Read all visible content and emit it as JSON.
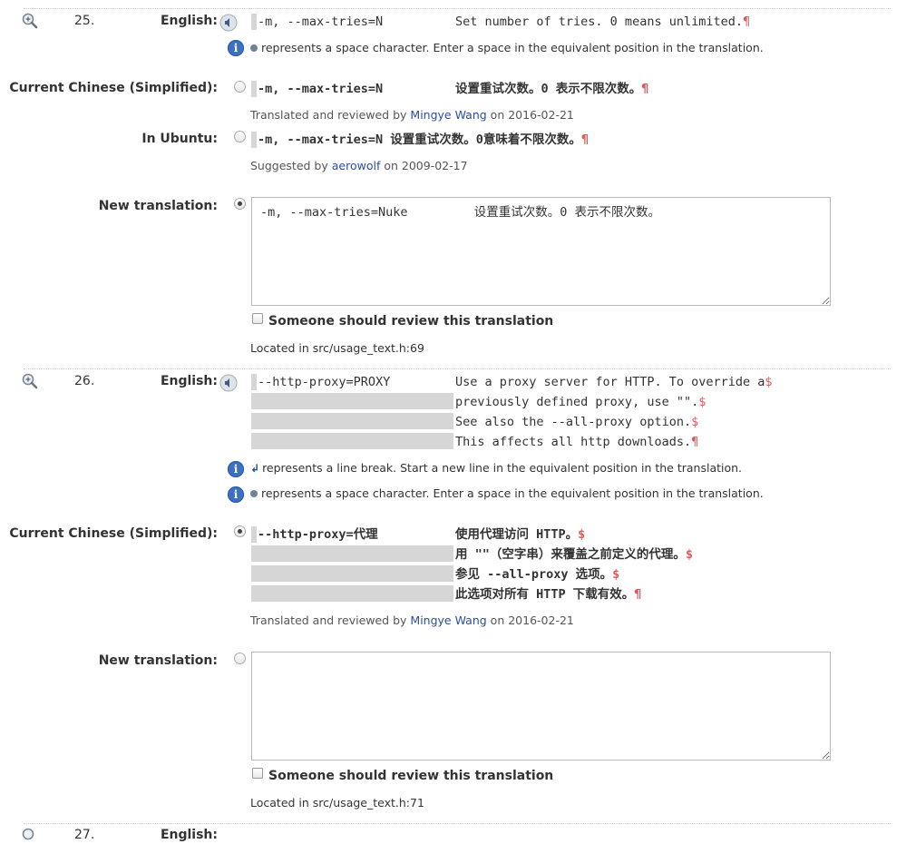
{
  "msg25": {
    "number": "25.",
    "english_label": "English:",
    "english": {
      "left": "-m, --max-tries=N",
      "right": "Set number of tries. 0 means unlimited.",
      "mark": "¶"
    },
    "space_note": "represents a space character. Enter a space in the equivalent position in the translation.",
    "current_label": "Current Chinese (Simplified):",
    "current": {
      "left": "-m, --max-tries=N",
      "right": "设置重试次数。0 表示不限次数。",
      "mark": "¶"
    },
    "current_meta": {
      "prefix": "Translated and reviewed by",
      "user": "Mingye Wang",
      "suffix": "on 2016-02-21"
    },
    "ubuntu_label": "In Ubuntu:",
    "ubuntu": {
      "text": "-m, --max-tries=N 设置重试次数。0意味着不限次数。",
      "mark": "¶"
    },
    "ubuntu_meta": {
      "prefix": "Suggested by",
      "user": "aerowolf",
      "suffix": "on 2009-02-17"
    },
    "new_label": "New translation:",
    "new_value": "-m, --max-tries=Nuke         设置重试次数。0 表示不限次数。",
    "review_label": "Someone should review this translation",
    "location": "Located in src/usage_text.h:69"
  },
  "msg26": {
    "number": "26.",
    "english_label": "English:",
    "english_left": "--http-proxy=PROXY",
    "english_lines": [
      {
        "text": "Use a proxy server for HTTP. To override a",
        "mark": "$"
      },
      {
        "text": "previously defined proxy, use \"\".",
        "mark": "$"
      },
      {
        "text": "See also the --all-proxy option.",
        "mark": "$"
      },
      {
        "text": "This affects all http downloads.",
        "mark": "¶"
      }
    ],
    "linebreak_note": "represents a line break. Start a new line in the equivalent position in the translation.",
    "space_note": "represents a space character. Enter a space in the equivalent position in the translation.",
    "current_label": "Current Chinese (Simplified):",
    "current_left": "--http-proxy=代理",
    "current_lines": [
      {
        "text": "使用代理访问 HTTP。",
        "mark": "$"
      },
      {
        "text": "用 \"\"（空字串）来覆盖之前定义的代理。",
        "mark": "$"
      },
      {
        "text": "参见 --all-proxy 选项。",
        "mark": "$"
      },
      {
        "text": "此选项对所有 HTTP 下载有效。",
        "mark": "¶"
      }
    ],
    "current_meta": {
      "prefix": "Translated and reviewed by",
      "user": "Mingye Wang",
      "suffix": "on 2016-02-21"
    },
    "new_label": "New translation:",
    "new_value": "",
    "review_label": "Someone should review this translation",
    "location": "Located in src/usage_text.h:71"
  },
  "msg27_partial": {
    "number": "27.",
    "english_label": "English:"
  }
}
